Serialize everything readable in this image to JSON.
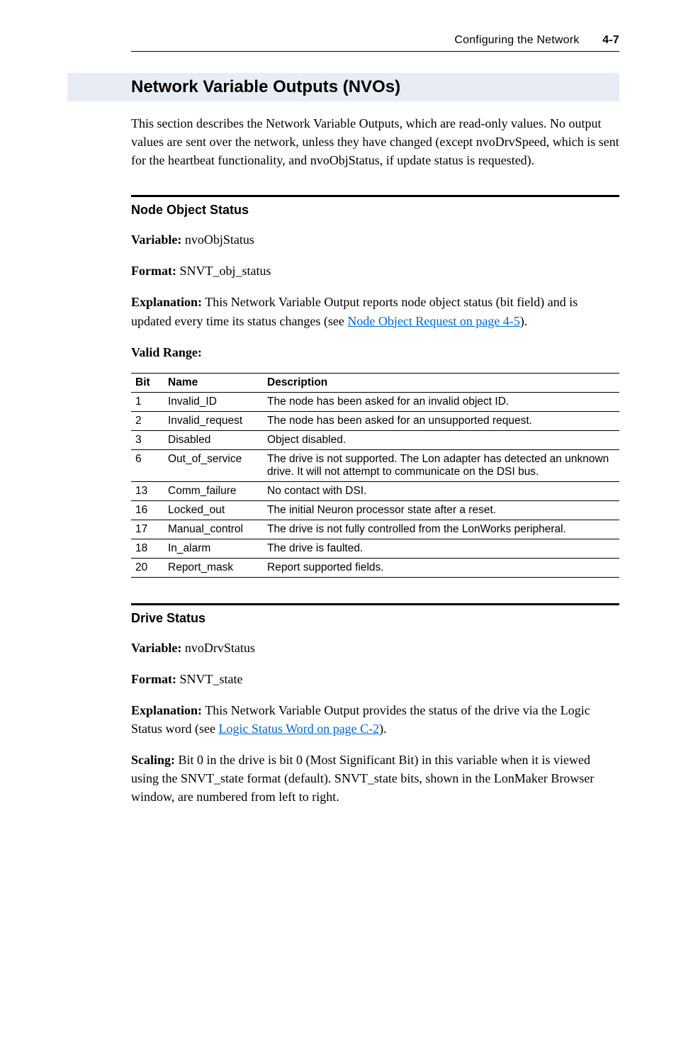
{
  "header": {
    "title": "Configuring the Network",
    "page": "4-7"
  },
  "section1": {
    "heading": "Network Variable Outputs (NVOs)",
    "intro": "This section describes the Network Variable Outputs, which are read-only values. No output values are sent over the network, unless they have changed (except nvoDrvSpeed, which is sent for the heartbeat functionality, and nvoObjStatus, if update status is requested)."
  },
  "nodeObj": {
    "heading": "Node Object Status",
    "variable_label": "Variable:",
    "variable_value": " nvoObjStatus",
    "format_label": "Format:",
    "format_value": " SNVT_obj_status",
    "explanation_label": "Explanation:",
    "explanation_text_pre": " This Network Variable Output reports node object status (bit field) and is updated every time its status changes (see ",
    "explanation_link": "Node Object Request on page 4-5",
    "explanation_text_post": ").",
    "valid_range_label": "Valid Range:",
    "col_bit": "Bit",
    "col_name": "Name",
    "col_desc": "Description",
    "rows": [
      {
        "bit": "1",
        "name": "Invalid_ID",
        "desc": "The node has been asked for an invalid object ID."
      },
      {
        "bit": "2",
        "name": "Invalid_request",
        "desc": "The node has been asked for an unsupported request."
      },
      {
        "bit": "3",
        "name": "Disabled",
        "desc": "Object disabled."
      },
      {
        "bit": "6",
        "name": "Out_of_service",
        "desc": "The drive is not supported. The Lon adapter has detected an unknown drive. It will not attempt to communicate on the DSI bus."
      },
      {
        "bit": "13",
        "name": "Comm_failure",
        "desc": "No contact with DSI."
      },
      {
        "bit": "16",
        "name": "Locked_out",
        "desc": "The initial Neuron processor state after a reset."
      },
      {
        "bit": "17",
        "name": "Manual_control",
        "desc": "The drive is not fully controlled from the LonWorks peripheral."
      },
      {
        "bit": "18",
        "name": "In_alarm",
        "desc": "The drive is faulted."
      },
      {
        "bit": "20",
        "name": "Report_mask",
        "desc": "Report supported fields."
      }
    ]
  },
  "drvStatus": {
    "heading": "Drive Status",
    "variable_label": "Variable:",
    "variable_value": " nvoDrvStatus",
    "format_label": "Format:",
    "format_value": " SNVT_state",
    "explanation_label": "Explanation:",
    "explanation_text_pre": " This Network Variable Output provides the status of the drive via the Logic Status word (see ",
    "explanation_link": "Logic Status Word on page C-2",
    "explanation_text_post": ").",
    "scaling_label": "Scaling:",
    "scaling_text": " Bit 0 in the drive is bit 0 (Most Significant Bit) in this variable when it is viewed using the SNVT_state format (default). SNVT_state bits, shown in the LonMaker Browser window, are numbered from left to right."
  }
}
